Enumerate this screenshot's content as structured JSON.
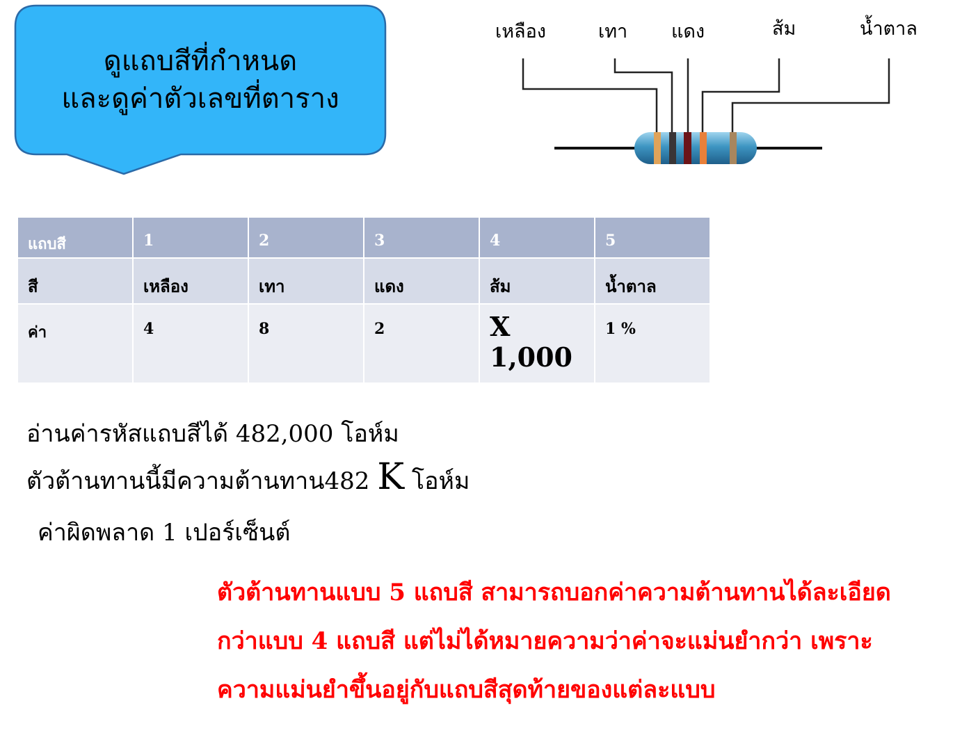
{
  "callout": {
    "line1": "ดูแถบสีที่กำหนด",
    "line2": "และดูค่าตัวเลขที่ตาราง",
    "fill": "#33b5f9"
  },
  "diagram": {
    "labels": [
      {
        "text": "เหลือง",
        "color_name": "yellow"
      },
      {
        "text": "เทา",
        "color_name": "grey"
      },
      {
        "text": "แดง",
        "color_name": "red"
      },
      {
        "text": "ส้ม",
        "color_name": "orange"
      },
      {
        "text": "น้ำตาล",
        "color_name": "brown"
      }
    ],
    "body_color": "#3e95c2",
    "band_colors": [
      "#e0a35a",
      "#3a3536",
      "#6b1418",
      "#e8803a",
      "#a8865e"
    ]
  },
  "table": {
    "header": [
      "แถบสี",
      "1",
      "2",
      "3",
      "4",
      "5"
    ],
    "rows": [
      [
        "สี",
        "เหลือง",
        "เทา",
        "แดง",
        "ส้ม",
        "น้ำตาล"
      ],
      [
        "ค่า",
        "4",
        "8",
        "2",
        "X 1,000",
        "1 %"
      ]
    ],
    "colors": {
      "header": "#a8b3cd",
      "row1": "#d6dbe8",
      "row2": "#ebedf3"
    }
  },
  "reading": {
    "line1": "อ่านค่ารหัสแถบสีได้ 482,000 โอห์ม",
    "line2_before": "ตัวต้านทานนี้มีความต้านทาน482 ",
    "line2_k": "K",
    "line2_after": " โอห์ม",
    "line3": "ค่าผิดพลาด 1 เปอร์เซ็นต์"
  },
  "note": {
    "line1": "ตัวต้านทานแบบ 5 แถบสี สามารถบอกค่าความต้านทานได้ละเอียด",
    "line2": "กว่าแบบ 4 แถบสี แต่ไม่ได้หมายความว่าค่าจะแม่นยำกว่า เพราะ",
    "line3": "ความแม่นยำขึ้นอยู่กับแถบสีสุดท้ายของแต่ละแบบ",
    "color": "#ff0000"
  }
}
